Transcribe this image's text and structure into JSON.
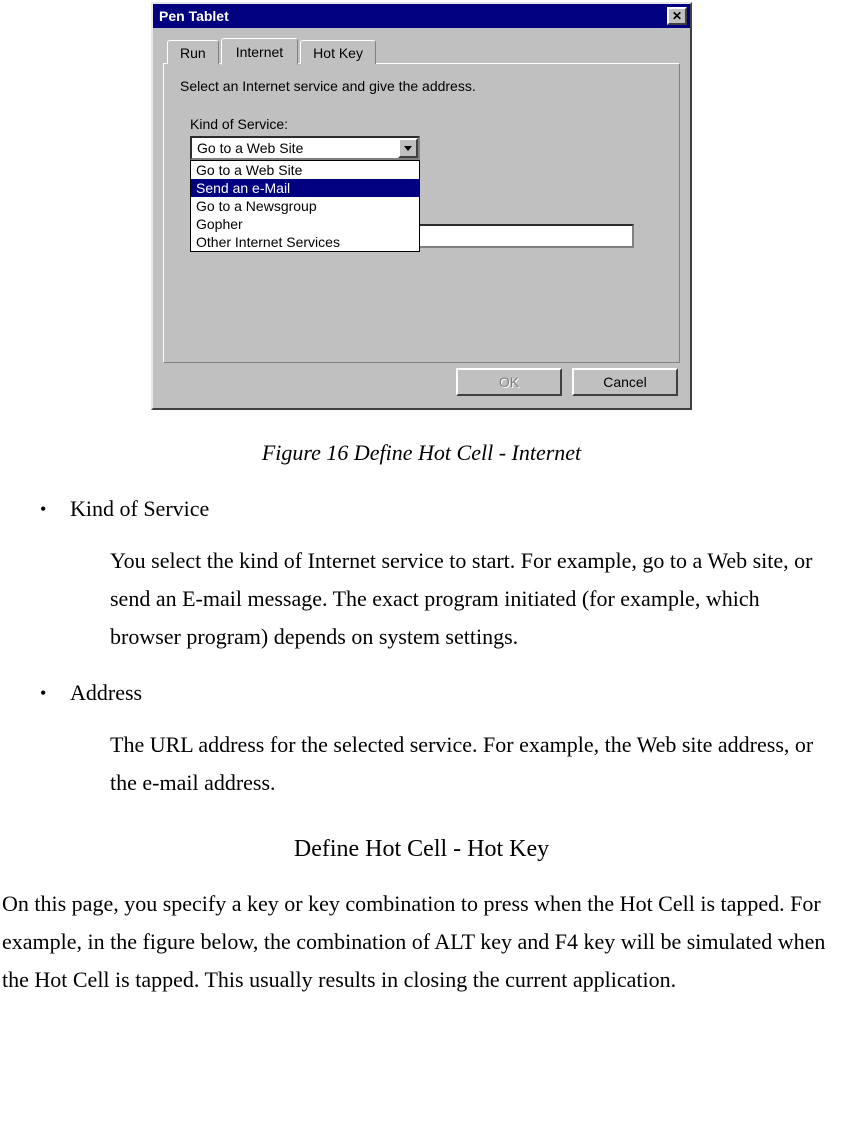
{
  "dialog": {
    "title": "Pen Tablet",
    "tabs": [
      "Run",
      "Internet",
      "Hot Key"
    ],
    "active_tab": 1,
    "instruction": "Select an Internet service and give the address.",
    "field_label": "Kind of Service:",
    "selected_value": "Go to a Web Site",
    "dropdown_options": [
      "Go to a Web Site",
      "Send an e-Mail",
      "Go to a Newsgroup",
      "Gopher",
      "Other Internet Services"
    ],
    "highlighted_index": 1,
    "ok_label": "OK",
    "cancel_label": "Cancel"
  },
  "figure_caption": "Figure 16 Define Hot Cell - Internet",
  "bullets": [
    {
      "title": "Kind of Service",
      "body": "You select the kind of Internet service to start. For example, go to a Web site, or send an E-mail message. The exact program initiated (for example, which browser program) depends on system settings."
    },
    {
      "title": "Address",
      "body": "The URL address for the selected service. For example, the Web site address, or the e-mail address."
    }
  ],
  "section_heading": "Define Hot Cell - Hot Key",
  "section_body": "On this page, you specify a key or key combination to press when the Hot Cell is tapped. For example, in the figure below, the combination of ALT key and F4 key will be simulated when the Hot Cell is tapped. This usually results in closing the current application."
}
